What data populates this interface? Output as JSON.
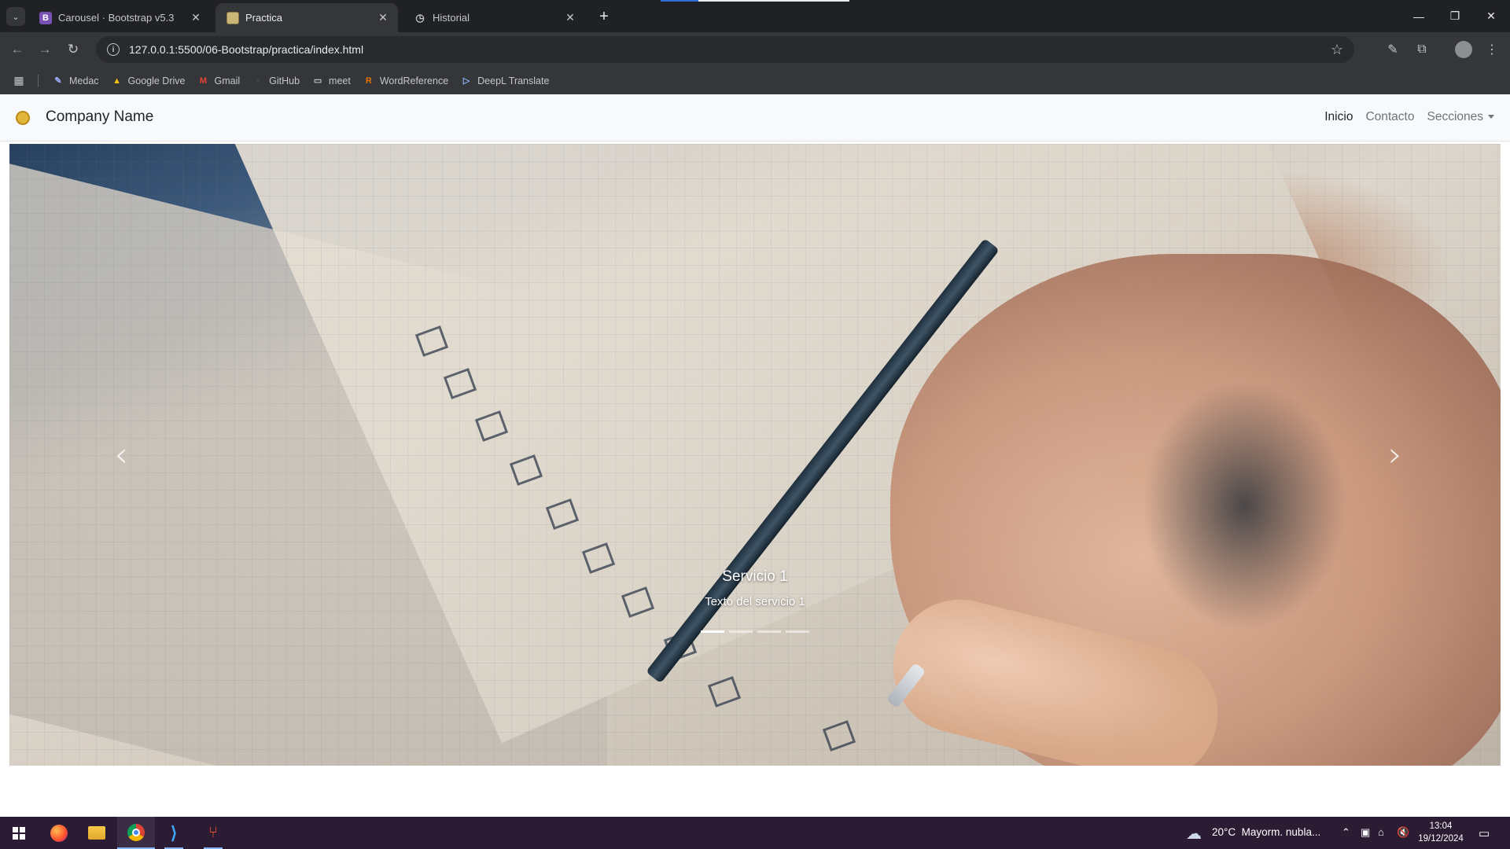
{
  "browser": {
    "tabs": [
      {
        "title": "Carousel · Bootstrap v5.3",
        "favicon": "bootstrap-icon",
        "active": false
      },
      {
        "title": "Practica",
        "favicon": "page-icon",
        "active": true
      },
      {
        "title": "Historial",
        "favicon": "history-icon",
        "active": false
      }
    ],
    "url": "127.0.0.1:5500/06-Bootstrap/practica/index.html",
    "bookmarks": [
      {
        "label": "Medac",
        "icon": "medac-icon"
      },
      {
        "label": "Google Drive",
        "icon": "google-drive-icon"
      },
      {
        "label": "Gmail",
        "icon": "gmail-icon"
      },
      {
        "label": "GitHub",
        "icon": "github-icon"
      },
      {
        "label": "meet",
        "icon": "folder-icon"
      },
      {
        "label": "WordReference",
        "icon": "wordreference-icon"
      },
      {
        "label": "DeepL Translate",
        "icon": "deepl-icon"
      }
    ]
  },
  "site": {
    "brand": "Company Name",
    "nav": [
      {
        "label": "Inicio",
        "active": true
      },
      {
        "label": "Contacto",
        "active": false
      },
      {
        "label": "Secciones",
        "active": false,
        "dropdown": true
      }
    ],
    "carousel": {
      "caption_title": "Servicio 1",
      "caption_text": "Texto del servicio 1",
      "slide_count": 4,
      "active_index": 0,
      "prev_icon": "chevron-left-icon",
      "next_icon": "chevron-right-icon"
    }
  },
  "taskbar": {
    "apps": [
      "windows-start-icon",
      "firefox-icon",
      "file-explorer-icon",
      "chrome-icon",
      "vscode-icon",
      "git-icon"
    ],
    "weather": "20°C  Mayorm. nubla...",
    "time": "13:04",
    "date": "19/12/2024"
  },
  "colors": {
    "navbar_bg": "#f8f9fa",
    "brand_text": "#212529",
    "nav_link": "#6c757d",
    "taskbar_bg": "#2b1c33",
    "browser_dark": "#202124"
  }
}
